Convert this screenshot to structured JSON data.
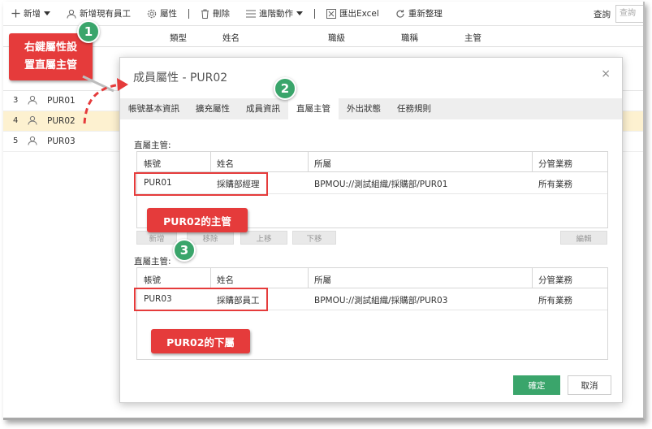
{
  "toolbar": {
    "new_label": "新增",
    "add_existing_label": "新增現有員工",
    "properties_label": "屬性",
    "delete_label": "刪除",
    "advanced_label": "進階動作",
    "export_label": "匯出Excel",
    "refresh_label": "重新整理",
    "query_label": "查詢",
    "query_placeholder": "查詢"
  },
  "grid": {
    "headers": {
      "type": "類型",
      "name": "姓名",
      "rank": "職級",
      "title": "職稱",
      "manager": "主管"
    },
    "rows": [
      {
        "num": "3",
        "code": "PUR01"
      },
      {
        "num": "4",
        "code": "PUR02"
      },
      {
        "num": "5",
        "code": "PUR03"
      }
    ]
  },
  "modal": {
    "title": "成員屬性 - PUR02",
    "close": "×",
    "tabs": [
      "帳號基本資訊",
      "擴充屬性",
      "成員資訊",
      "直屬主管",
      "外出狀態",
      "任務規則"
    ],
    "section1": {
      "label": "直屬主管:",
      "headers": {
        "account": "帳號",
        "name": "姓名",
        "belongs": "所屬",
        "scope": "分管業務"
      },
      "row": {
        "account": "PUR01",
        "name": "採購部經理",
        "belongs": "BPMOU://測試組織/採購部/PUR01",
        "scope": "所有業務"
      }
    },
    "buttons": {
      "add": "新增",
      "remove": "移除",
      "up": "上移",
      "down": "下移",
      "edit": "編輯"
    },
    "section2": {
      "label": "直屬主管:",
      "headers": {
        "account": "帳號",
        "name": "姓名",
        "belongs": "所屬",
        "scope": "分管業務"
      },
      "row": {
        "account": "PUR03",
        "name": "採購部員工",
        "belongs": "BPMOU://測試組織/採購部/PUR03",
        "scope": "所有業務"
      }
    },
    "ok": "確定",
    "cancel": "取消"
  },
  "annotations": {
    "callout1": "右鍵屬性設置直屬主管",
    "callout1_line1": "右鍵屬性設",
    "callout1_line2": "置直屬主管",
    "callout2": "PUR02的主管",
    "callout3": "PUR02的下屬",
    "badge1": "1",
    "badge2": "2",
    "badge3": "3"
  },
  "colors": {
    "accent_green": "#3aa56b",
    "annotation_red": "#e53b3b",
    "selected_row": "#fdf1d0"
  }
}
